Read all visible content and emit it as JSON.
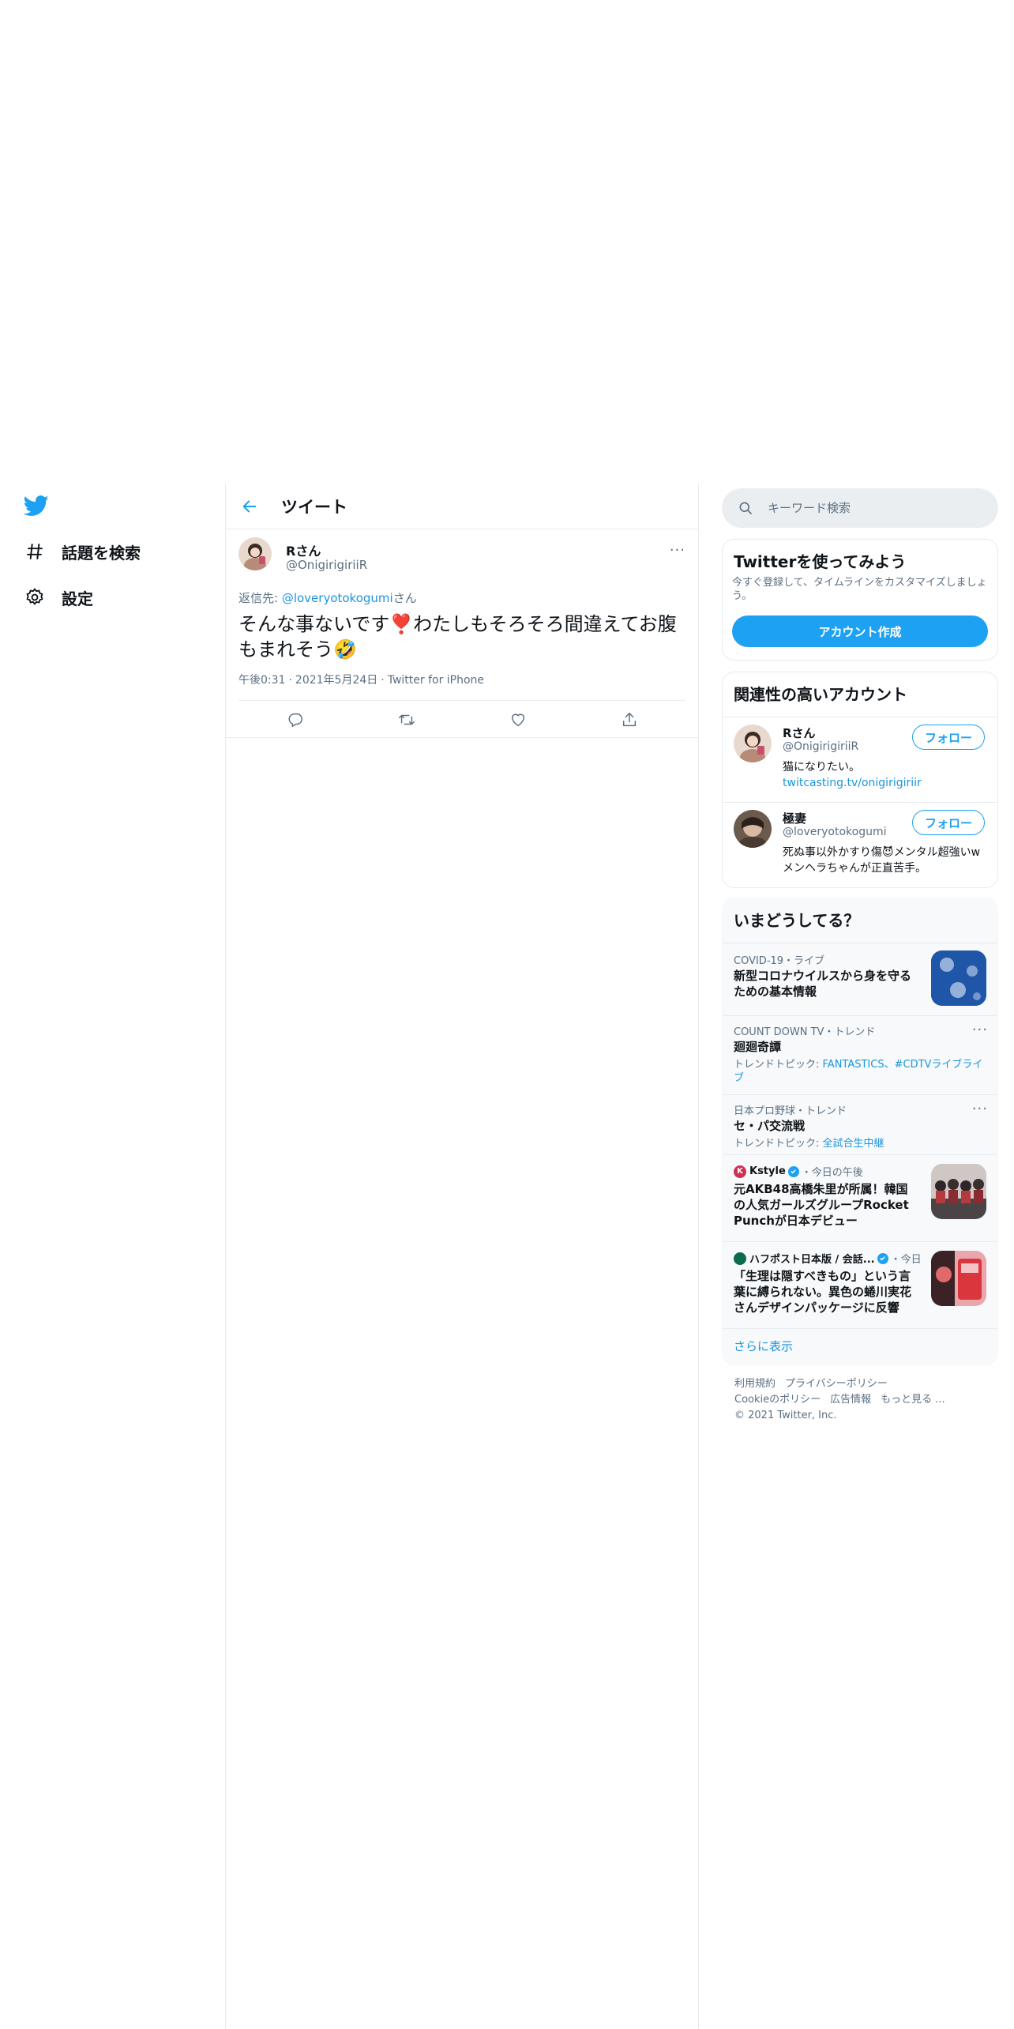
{
  "nav": {
    "items": [
      {
        "label": "話題を検索",
        "icon": "hashtag-icon"
      },
      {
        "label": "設定",
        "icon": "gear-icon"
      }
    ]
  },
  "header": {
    "title": "ツイート"
  },
  "tweet": {
    "name": "Rさん",
    "handle": "@OnigirigiriiR",
    "reply_prefix": "返信先: ",
    "reply_user": "@loveryotokogumi",
    "reply_suffix": "さん",
    "text": "そんな事ないです❣️わたしもそろそろ間違えてお腹もまれそう🤣",
    "time": "午後0:31",
    "date": "2021年5月24日",
    "source": "Twitter for iPhone",
    "meta_sep": "·"
  },
  "search": {
    "placeholder": "キーワード検索"
  },
  "signup": {
    "title": "Twitterを使ってみよう",
    "desc": "今すぐ登録して、タイムラインをカスタマイズしましょう。",
    "button": "アカウント作成"
  },
  "relevant": {
    "title": "関連性の高いアカウント",
    "accounts": [
      {
        "name": "Rさん",
        "handle": "@OnigirigiriiR",
        "bio_text": "猫になりたい。",
        "bio_link": "twitcasting.tv/onigirigiriir",
        "follow": "フォロー"
      },
      {
        "name": "極妻",
        "handle": "@loveryotokogumi",
        "bio_text": "死ぬ事以外かすり傷😈メンタル超強いwメンヘラちゃんが正直苦手。",
        "bio_link": "",
        "follow": "フォロー"
      }
    ]
  },
  "trends": {
    "title": "いまどうしてる？",
    "items": [
      {
        "meta": "COVID-19・ライブ",
        "title": "新型コロナウイルスから身を守るための基本情報"
      },
      {
        "meta": "COUNT DOWN TV・トレンド",
        "title": "廻廻奇譚",
        "sub_prefix": "トレンドトピック: ",
        "sub_links": "FANTASTICS、#CDTVライブライブ"
      },
      {
        "meta": "日本プロ野球・トレンド",
        "title": "セ・パ交流戦",
        "sub_prefix": "トレンドトピック: ",
        "sub_links": "全試合生中継"
      },
      {
        "source": "Kstyle",
        "meta": "・今日の午後",
        "title": "元AKB48高橋朱里が所属！韓国の人気ガールズグループRocket Punchが日本デビュー"
      },
      {
        "source": "ハフポスト日本版 / 会話...",
        "meta": "・今日",
        "title": "「生理は隠すべきもの」という言葉に縛られない。異色の蜷川実花さんデザインパッケージに反響"
      }
    ],
    "show_more": "さらに表示"
  },
  "footer": {
    "links1": [
      "利用規約",
      "プライバシーポリシー"
    ],
    "links2": [
      "Cookieのポリシー",
      "広告情報",
      "もっと見る ..."
    ],
    "copyright": "© 2021 Twitter, Inc."
  },
  "colors": {
    "accent": "#1da1f2",
    "link": "#1b95e0",
    "muted": "#5b7083",
    "border": "#e6ecf0"
  }
}
